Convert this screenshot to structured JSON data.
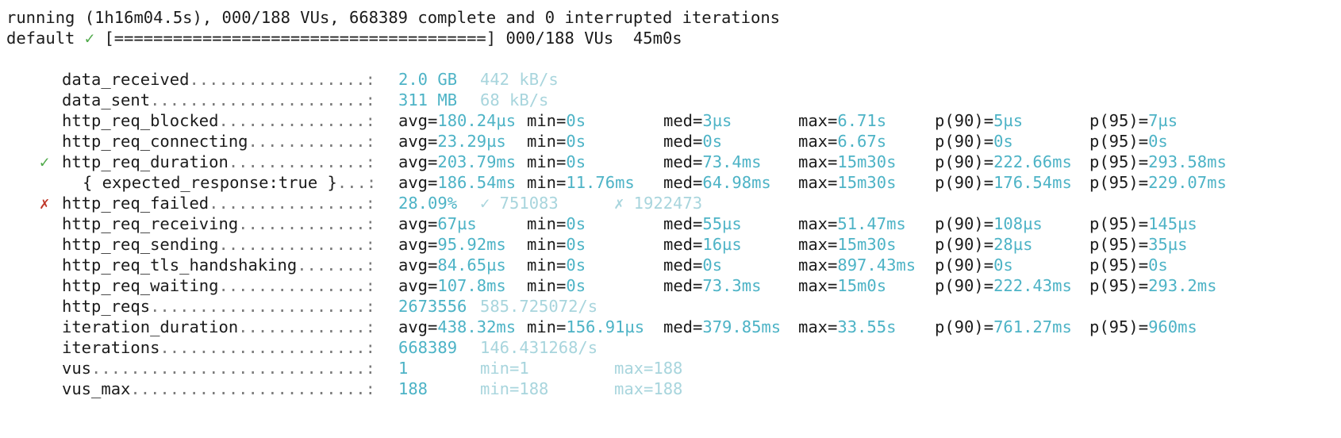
{
  "terminal": {
    "status_line": "running (1h16m04.5s), 000/188 VUs, 668389 complete and 0 interrupted iterations",
    "scenario": {
      "name": "default",
      "check": "✓",
      "progress": "[======================================]",
      "vus": "000/188 VUs",
      "duration": "45m0s"
    },
    "metrics": [
      {
        "mark": "",
        "name": "data_received",
        "dots": "..................: ",
        "simple": [
          "2.0 GB",
          "442 kB/s"
        ]
      },
      {
        "mark": "",
        "name": "data_sent",
        "dots": "......................: ",
        "simple": [
          "311 MB",
          "68 kB/s"
        ]
      },
      {
        "mark": "",
        "name": "http_req_blocked",
        "dots": "...............: ",
        "stats": [
          [
            "avg=",
            "180.24µs"
          ],
          [
            "min=",
            "0s"
          ],
          [
            "med=",
            "3µs"
          ],
          [
            "max=",
            "6.71s"
          ],
          [
            "p(90)=",
            "5µs"
          ],
          [
            "p(95)=",
            "7µs"
          ]
        ]
      },
      {
        "mark": "",
        "name": "http_req_connecting",
        "dots": "............: ",
        "stats": [
          [
            "avg=",
            "23.29µs"
          ],
          [
            "min=",
            "0s"
          ],
          [
            "med=",
            "0s"
          ],
          [
            "max=",
            "6.67s"
          ],
          [
            "p(90)=",
            "0s"
          ],
          [
            "p(95)=",
            "0s"
          ]
        ]
      },
      {
        "mark": "✓",
        "name": "http_req_duration",
        "dots": "..............: ",
        "stats": [
          [
            "avg=",
            "203.79ms"
          ],
          [
            "min=",
            "0s"
          ],
          [
            "med=",
            "73.4ms"
          ],
          [
            "max=",
            "15m30s"
          ],
          [
            "p(90)=",
            "222.66ms"
          ],
          [
            "p(95)=",
            "293.58ms"
          ]
        ]
      },
      {
        "mark": "",
        "name": "{ expected_response:true }",
        "dots": "...: ",
        "nested": true,
        "stats": [
          [
            "avg=",
            "186.54ms"
          ],
          [
            "min=",
            "11.76ms"
          ],
          [
            "med=",
            "64.98ms"
          ],
          [
            "max=",
            "15m30s"
          ],
          [
            "p(90)=",
            "176.54ms"
          ],
          [
            "p(95)=",
            "229.07ms"
          ]
        ]
      },
      {
        "mark": "✗",
        "name": "http_req_failed",
        "dots": "................: ",
        "simple": [
          "28.09%",
          "✓ 751083",
          "✗ 1922473"
        ]
      },
      {
        "mark": "",
        "name": "http_req_receiving",
        "dots": ".............: ",
        "stats": [
          [
            "avg=",
            "67µs"
          ],
          [
            "min=",
            "0s"
          ],
          [
            "med=",
            "55µs"
          ],
          [
            "max=",
            "51.47ms"
          ],
          [
            "p(90)=",
            "108µs"
          ],
          [
            "p(95)=",
            "145µs"
          ]
        ]
      },
      {
        "mark": "",
        "name": "http_req_sending",
        "dots": "...............: ",
        "stats": [
          [
            "avg=",
            "95.92ms"
          ],
          [
            "min=",
            "0s"
          ],
          [
            "med=",
            "16µs"
          ],
          [
            "max=",
            "15m30s"
          ],
          [
            "p(90)=",
            "28µs"
          ],
          [
            "p(95)=",
            "35µs"
          ]
        ]
      },
      {
        "mark": "",
        "name": "http_req_tls_handshaking",
        "dots": ".......: ",
        "stats": [
          [
            "avg=",
            "84.65µs"
          ],
          [
            "min=",
            "0s"
          ],
          [
            "med=",
            "0s"
          ],
          [
            "max=",
            "897.43ms"
          ],
          [
            "p(90)=",
            "0s"
          ],
          [
            "p(95)=",
            "0s"
          ]
        ]
      },
      {
        "mark": "",
        "name": "http_req_waiting",
        "dots": "...............: ",
        "stats": [
          [
            "avg=",
            "107.8ms"
          ],
          [
            "min=",
            "0s"
          ],
          [
            "med=",
            "73.3ms"
          ],
          [
            "max=",
            "15m0s"
          ],
          [
            "p(90)=",
            "222.43ms"
          ],
          [
            "p(95)=",
            "293.2ms"
          ]
        ]
      },
      {
        "mark": "",
        "name": "http_reqs",
        "dots": "......................: ",
        "simple": [
          "2673556",
          "585.725072/s"
        ]
      },
      {
        "mark": "",
        "name": "iteration_duration",
        "dots": ".............: ",
        "stats": [
          [
            "avg=",
            "438.32ms"
          ],
          [
            "min=",
            "156.91µs"
          ],
          [
            "med=",
            "379.85ms"
          ],
          [
            "max=",
            "33.55s"
          ],
          [
            "p(90)=",
            "761.27ms"
          ],
          [
            "p(95)=",
            "960ms"
          ]
        ]
      },
      {
        "mark": "",
        "name": "iterations",
        "dots": ".....................: ",
        "simple": [
          "668389",
          "146.431268/s"
        ]
      },
      {
        "mark": "",
        "name": "vus",
        "dots": "............................: ",
        "simple": [
          "1",
          "min=1",
          "max=188"
        ]
      },
      {
        "mark": "",
        "name": "vus_max",
        "dots": "........................: ",
        "simple": [
          "188",
          "min=188",
          "max=188"
        ]
      }
    ]
  },
  "colors": {
    "value": "#4db3c6",
    "faint_value": "#a8d5dd",
    "check_ok": "#4fa94a",
    "check_fail": "#c0392b",
    "text": "#1b1b1b",
    "background": "#ffffff"
  }
}
